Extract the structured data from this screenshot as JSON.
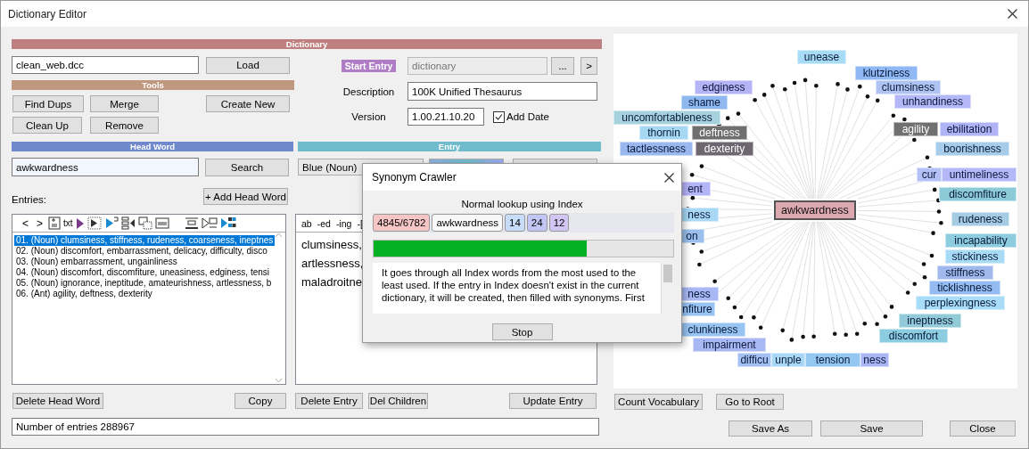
{
  "window": {
    "title": "Dictionary Editor"
  },
  "dictionary": {
    "header": "Dictionary",
    "file": "clean_web.dcc",
    "load_button": "Load",
    "start_entry_label": "Start Entry",
    "start_entry": "dictionary",
    "browse_button": "...",
    "next_button": ">",
    "description_label": "Description",
    "description": "100K Unified Thesaurus",
    "version_label": "Version",
    "version": "1.00.21.10.20",
    "add_date": {
      "label": "Add Date",
      "checked": true
    }
  },
  "tools": {
    "header": "Tools",
    "buttons": [
      "Find Dups",
      "Merge",
      "Create New",
      "Clean Up",
      "Remove"
    ]
  },
  "head_word": {
    "header": "Head Word",
    "value": "awkwardness",
    "search_button": "Search",
    "entries_label": "Entries:",
    "add_button": "+ Add Head Word",
    "toolbar": [
      {
        "kind": "text",
        "label": "<"
      },
      {
        "kind": "text",
        "label": ">"
      },
      {
        "kind": "page"
      },
      {
        "kind": "labeled",
        "label": "txt"
      },
      {
        "kind": "play"
      },
      {
        "kind": "step"
      },
      {
        "kind": "triangle"
      },
      {
        "kind": "columns"
      },
      {
        "kind": "pages"
      },
      {
        "kind": "window"
      },
      {
        "kind": "insert"
      },
      {
        "kind": "box"
      },
      {
        "kind": "grid"
      }
    ],
    "entries": [
      {
        "text": "01. (Noun) clumsiness, stiffness, rudeness, coarseness, ineptnes",
        "selected": true
      },
      {
        "text": "02. (Noun) discomfort, embarrassment, delicacy, difficulty, disco",
        "selected": false
      },
      {
        "text": "03. (Noun) embarrassment, ungainliness",
        "selected": false
      },
      {
        "text": "04. (Noun) discomfort, discomfiture, uneasiness, edginess, tensi",
        "selected": false
      },
      {
        "text": "05. (Noun) ignorance, ineptitude, amateurishness, artlessness, b",
        "selected": false
      },
      {
        "text": "06. (Ant) agility, deftness, dexterity",
        "selected": false
      }
    ]
  },
  "entry": {
    "header": "Entry",
    "part_of_speech": "Blue (Noun)",
    "toolbar": [
      "ab",
      "-ed",
      "-ing",
      "-["
    ],
    "lines": [
      "clumsiness,",
      "artlessness,",
      "maladroitne"
    ]
  },
  "left_buttons": [
    "Delete Head Word",
    "Copy",
    "Delete Entry",
    "Del Children",
    "Update Entry"
  ],
  "status": "Number of entries 288967",
  "graph": {
    "center": "awkwardness",
    "tags": [
      {
        "text": "unease",
        "color": "#a8dcf6"
      },
      {
        "text": "klutziness",
        "color": "#8fb8f4"
      },
      {
        "text": "edginess",
        "color": "#b4b4f6"
      },
      {
        "text": "clumsiness",
        "color": "#b0c4f4"
      },
      {
        "text": "shame",
        "color": "#8fb8f0"
      },
      {
        "text": "unhandiness",
        "color": "#b4b8f6"
      },
      {
        "text": "uncomfortableness",
        "color": "#a6d2de"
      },
      {
        "text": "thornin",
        "color": "#a6d8f4"
      },
      {
        "text": "deftness",
        "color": "#6f6f6f"
      },
      {
        "text": "agility",
        "color": "#707070"
      },
      {
        "text": "ebilitation",
        "color": "#b0b4f6"
      },
      {
        "text": "tactlessness",
        "color": "#9ab8ee"
      },
      {
        "text": "dexterity",
        "color": "#6e6670"
      },
      {
        "text": "boorishness",
        "color": "#a6ccea"
      },
      {
        "text": "ent",
        "color": "#b4b4f8"
      },
      {
        "text": "cur",
        "color": "#b4c0f6"
      },
      {
        "text": "untimeliness",
        "color": "#b4b8f8"
      },
      {
        "text": "discomfiture",
        "color": "#8ccad8"
      },
      {
        "text": "ness",
        "color": "#a8d8f6"
      },
      {
        "text": "rudeness",
        "color": "#a6cce4"
      },
      {
        "text": "on",
        "color": "#9cc0ee"
      },
      {
        "text": "incapability",
        "color": "#8ecce0"
      },
      {
        "text": "stickiness",
        "color": "#a8dcf6"
      },
      {
        "text": "stiffness",
        "color": "#a0b8ec"
      },
      {
        "text": "ness",
        "color": "#a8b8f4"
      },
      {
        "text": "ticklishness",
        "color": "#94bcf2"
      },
      {
        "text": "nfiture",
        "color": "#98c4f2"
      },
      {
        "text": "perplexingness",
        "color": "#a8dcf8"
      },
      {
        "text": "clunkiness",
        "color": "#98c4f2"
      },
      {
        "text": "ineptness",
        "color": "#92cad8"
      },
      {
        "text": "impairment",
        "color": "#a8b8f4"
      },
      {
        "text": "discomfort",
        "color": "#8ccce0"
      },
      {
        "text": "difficu",
        "color": "#a4c0f2"
      },
      {
        "text": "unple",
        "color": "#a8d8f6"
      },
      {
        "text": "tension",
        "color": "#94c8f2"
      },
      {
        "text": "ness",
        "color": "#a8b4f4"
      }
    ]
  },
  "graph_buttons": [
    "Count Vocabulary",
    "Go to Root"
  ],
  "footer_buttons": [
    "Save As",
    "Save",
    "Close"
  ],
  "dialog": {
    "title": "Synonym Crawler",
    "mode": "Normal lookup using Index",
    "badges": [
      {
        "text": "4845/6782",
        "color": "#f6c6c6"
      },
      {
        "text": "awkwardness",
        "color": "#f8f8f8"
      },
      {
        "text": "14",
        "color": "#c6dcf8"
      },
      {
        "text": "24",
        "color": "#c2c6f4"
      },
      {
        "text": "12",
        "color": "#d2c6f4"
      }
    ],
    "progress": {
      "level": 0.71
    },
    "description": "It goes through all Index words from the most used to the least used. If the entry in Index doesn't exist in the current dictionary, it will be created, then filled with synonyms. First",
    "stop_button": "Stop"
  }
}
